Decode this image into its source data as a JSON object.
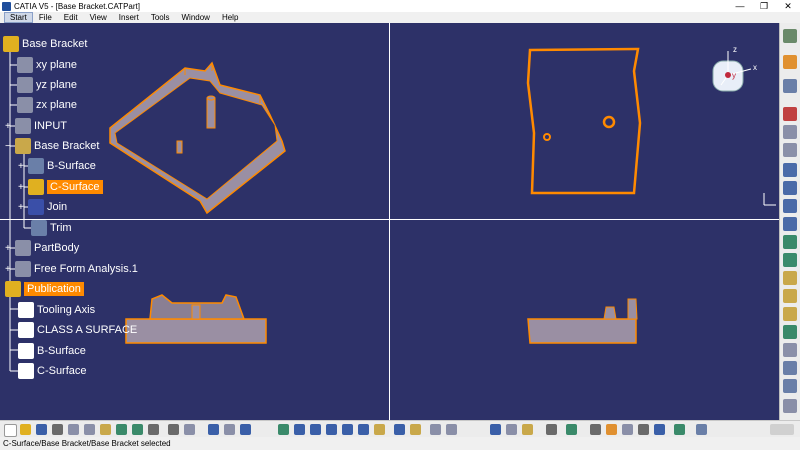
{
  "window": {
    "title": "CATIA V5 - [Base Bracket.CATPart]"
  },
  "menu": [
    "Start",
    "File",
    "Edit",
    "View",
    "Insert",
    "Tools",
    "Window",
    "Help"
  ],
  "tree": {
    "root": "Base Bracket",
    "items": [
      {
        "label": "xy plane"
      },
      {
        "label": "yz plane"
      },
      {
        "label": "zx plane"
      },
      {
        "label": "INPUT"
      },
      {
        "label": "Base Bracket"
      },
      {
        "label": "B-Surface"
      },
      {
        "label": "C-Surface"
      },
      {
        "label": "Join"
      },
      {
        "label": "Trim"
      },
      {
        "label": "PartBody"
      },
      {
        "label": "Free Form Analysis.1"
      },
      {
        "label": "Publication"
      },
      {
        "label": "Tooling Axis"
      },
      {
        "label": "CLASS A SURFACE"
      },
      {
        "label": "B-Surface"
      },
      {
        "label": "C-Surface"
      }
    ]
  },
  "compass": {
    "axes": [
      "z",
      "y",
      "x"
    ]
  },
  "status": {
    "text": "C-Surface/Base Bracket/Base Bracket selected"
  },
  "colors": {
    "background": "#2d3168",
    "highlight": "#ff8a00",
    "part": "#9a8fa3"
  }
}
